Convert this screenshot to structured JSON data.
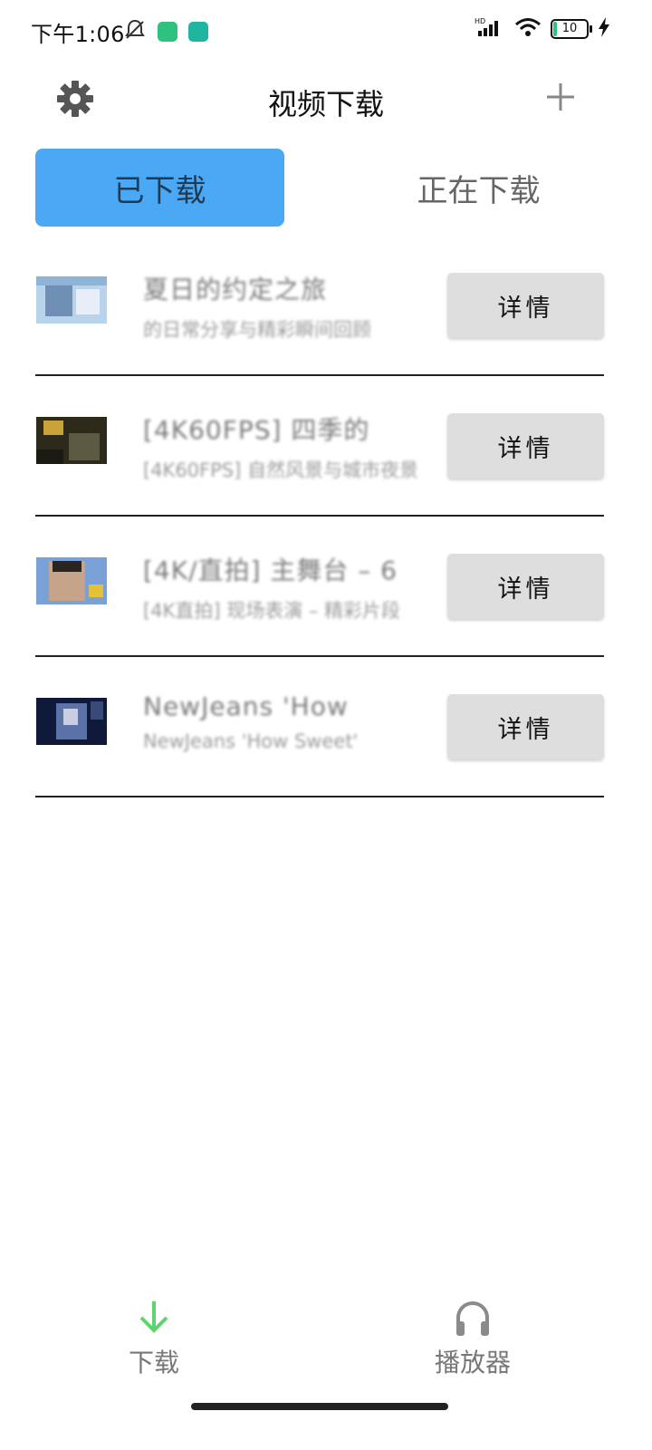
{
  "status_bar": {
    "time": "下午1:06",
    "battery": "10",
    "network": "HD"
  },
  "app_bar": {
    "title": "视频下载"
  },
  "tabs": [
    {
      "label": "已下载",
      "active": true
    },
    {
      "label": "正在下载",
      "active": false
    }
  ],
  "items": [
    {
      "title": "夏日的约定之旅",
      "subtitle": "的日常分享与精彩瞬间回顾",
      "button": "详情",
      "thumb_colors": [
        "#b9d4ea",
        "#6f8fb5",
        "#e7eef7"
      ]
    },
    {
      "title": "[4K60FPS] 四季的",
      "subtitle": "[4K60FPS] 自然风景与城市夜景",
      "button": "详情",
      "thumb_colors": [
        "#2d2a1c",
        "#c9a23a",
        "#5d5a44"
      ]
    },
    {
      "title": "[4K/直拍] 主舞台 – 6",
      "subtitle": "[4K直拍] 现场表演 – 精彩片段",
      "button": "详情",
      "thumb_colors": [
        "#7aa0d8",
        "#c6a48a",
        "#2a2320"
      ]
    },
    {
      "title": "NewJeans 'How",
      "subtitle": "NewJeans 'How Sweet'",
      "button": "详情",
      "thumb_colors": [
        "#0f1a3a",
        "#5a72a8",
        "#c9cfe0"
      ]
    }
  ],
  "bottom_nav": [
    {
      "label": "下载",
      "icon": "download-arrow-icon",
      "color": "#5fd36e"
    },
    {
      "label": "播放器",
      "icon": "headphones-icon",
      "color": "#8a8a8a"
    }
  ],
  "colors": {
    "accent_tab": "#4aa8f4",
    "button_bg": "#dedede"
  }
}
